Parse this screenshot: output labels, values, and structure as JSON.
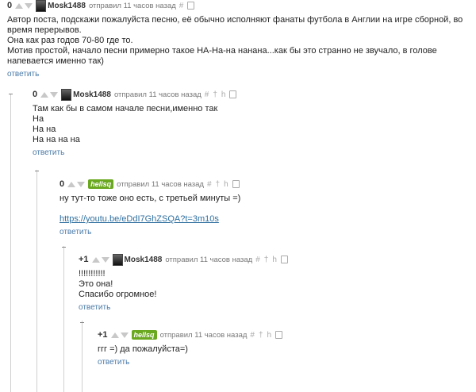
{
  "c1": {
    "rating": "0",
    "user": "Mosk1488",
    "meta": "отправил 11 часов назад",
    "lines": [
      "Автор поста, подскажи пожалуйста песню, её обычно исполняют фанаты футбола в Англии на игре сборной, во время перерывов.",
      "Она как раз годов 70-80 где то.",
      "Мотив простой, начало песни примерно такое НА-На-на нанана...как бы это странно не звучало, в голове напевается именно так)"
    ],
    "reply": "ответить"
  },
  "c2": {
    "rating": "0",
    "user": "Mosk1488",
    "meta": "отправил 11 часов назад",
    "lines": [
      "Там как бы в самом начале песни,именно так",
      "На",
      "На на",
      "На на на на"
    ],
    "reply": "ответить"
  },
  "c3": {
    "rating": "0",
    "user": "hellsq",
    "meta": "отправил 11 часов назад",
    "text": "ну тут-то тоже оно есть, с третьей минуты =)",
    "link": "https://youtu.be/eDdI7GhZSQA?t=3m10s",
    "reply": "ответить"
  },
  "c4": {
    "rating": "+1",
    "user": "Mosk1488",
    "meta": "отправил 11 часов назад",
    "lines": [
      "!!!!!!!!!!!",
      "Это она!",
      "Спасибо огромное!"
    ],
    "reply": "ответить"
  },
  "c5": {
    "rating": "+1",
    "user": "hellsq",
    "meta": "отправил 11 часов назад",
    "text": "ггг =) да пожалуйста=)",
    "reply": "ответить"
  },
  "tools": {
    "hash": "#",
    "plus": "†",
    "parent": "h"
  }
}
